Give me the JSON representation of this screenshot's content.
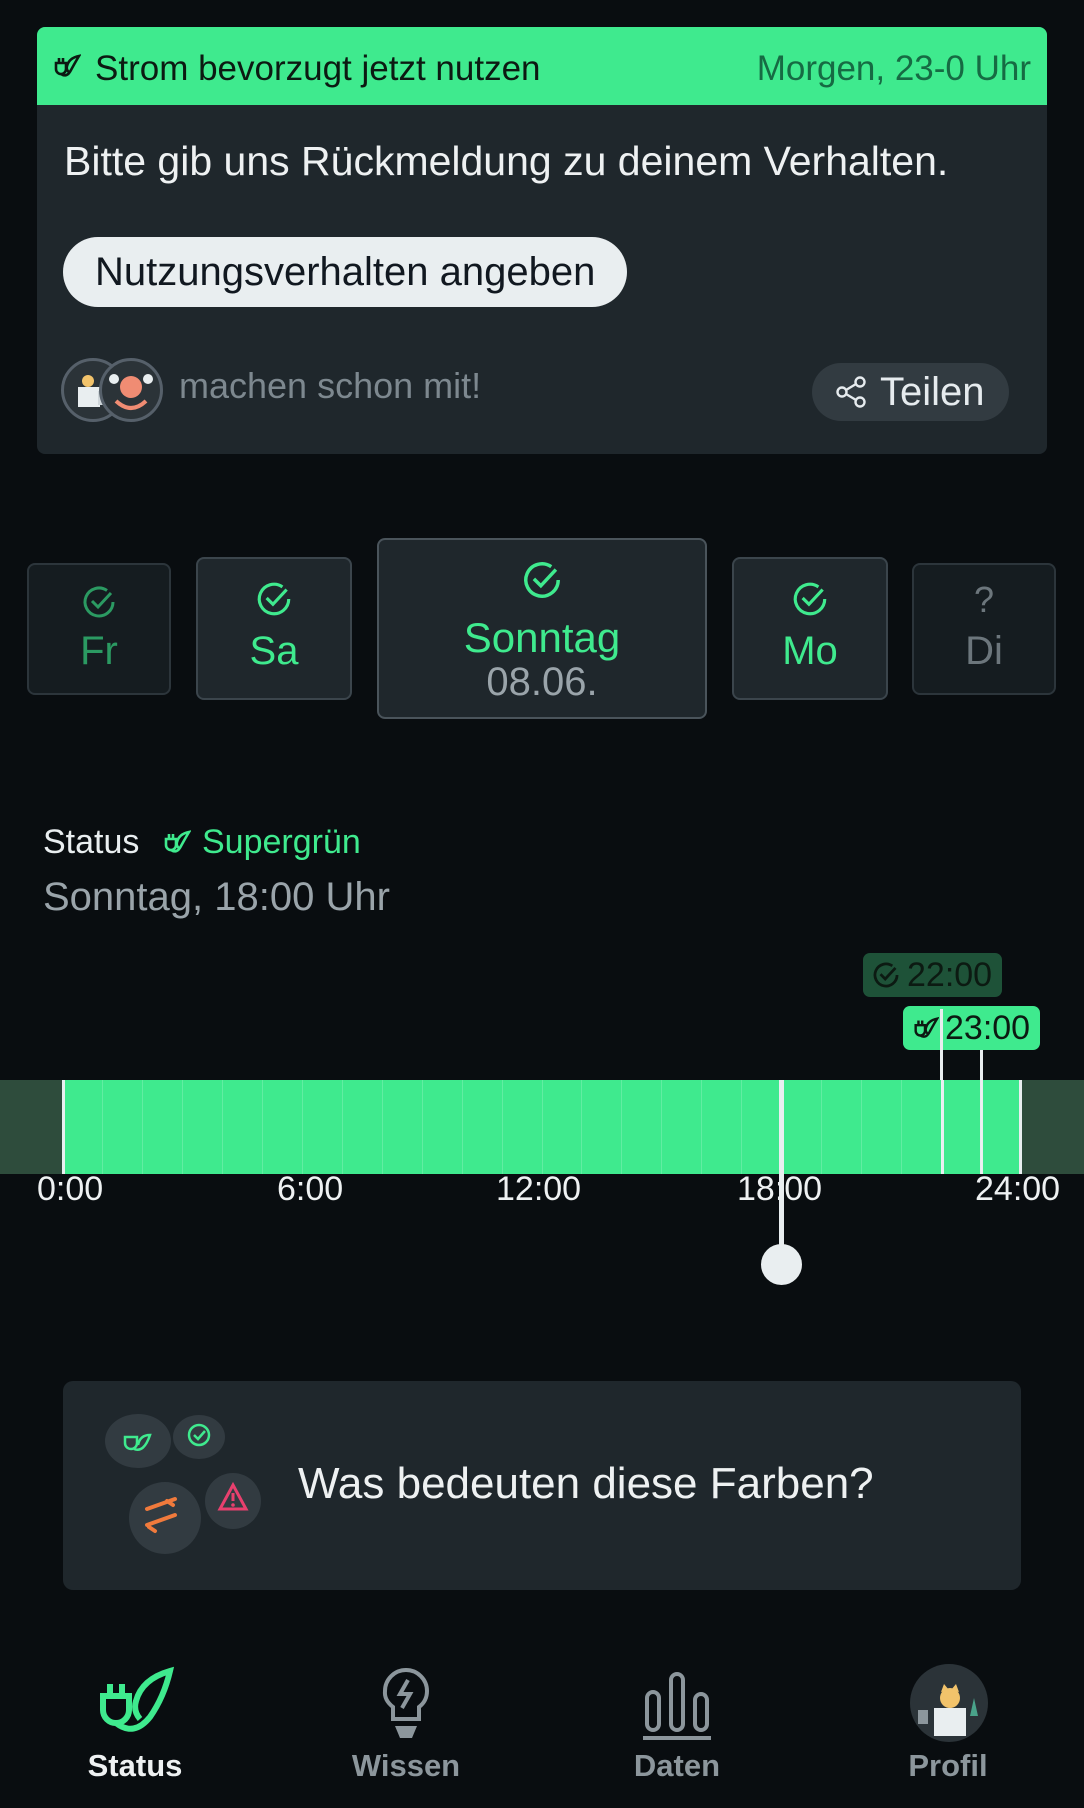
{
  "notice": {
    "title": "Strom bevorzugt jetzt nutzen",
    "time": "Morgen, 23-0 Uhr",
    "question": "Bitte gib uns Rückmeldung zu deinem Verhalten.",
    "button_label": "Nutzungsverhalten angeben",
    "participants_text": "machen schon mit!",
    "share_label": "Teilen"
  },
  "days": [
    {
      "label": "Fr",
      "icon": "check-circle-icon"
    },
    {
      "label": "Sa",
      "icon": "check-circle-icon"
    },
    {
      "label": "Sonntag",
      "date": "08.06.",
      "icon": "check-circle-icon",
      "selected": true
    },
    {
      "label": "Mo",
      "icon": "check-circle-icon"
    },
    {
      "label": "Di",
      "icon": "?"
    }
  ],
  "status": {
    "label": "Status",
    "value": "Supergrün",
    "time": "Sonntag, 18:00 Uhr"
  },
  "timeline": {
    "ticks": [
      "0:00",
      "6:00",
      "12:00",
      "18:00",
      "24:00"
    ],
    "badge_done": "22:00",
    "badge_green": "23:00",
    "current_hour": 18
  },
  "info": {
    "question": "Was bedeuten diese Farben?"
  },
  "nav": [
    {
      "label": "Status",
      "icon": "plug-leaf-icon",
      "active": true
    },
    {
      "label": "Wissen",
      "icon": "lightbulb-head-icon"
    },
    {
      "label": "Daten",
      "icon": "bar-chart-icon"
    },
    {
      "label": "Profil",
      "icon": "profile-avatar-icon"
    }
  ],
  "colors": {
    "accent_green": "#3fea8e",
    "card": "#1f272c",
    "background": "#090d10"
  }
}
